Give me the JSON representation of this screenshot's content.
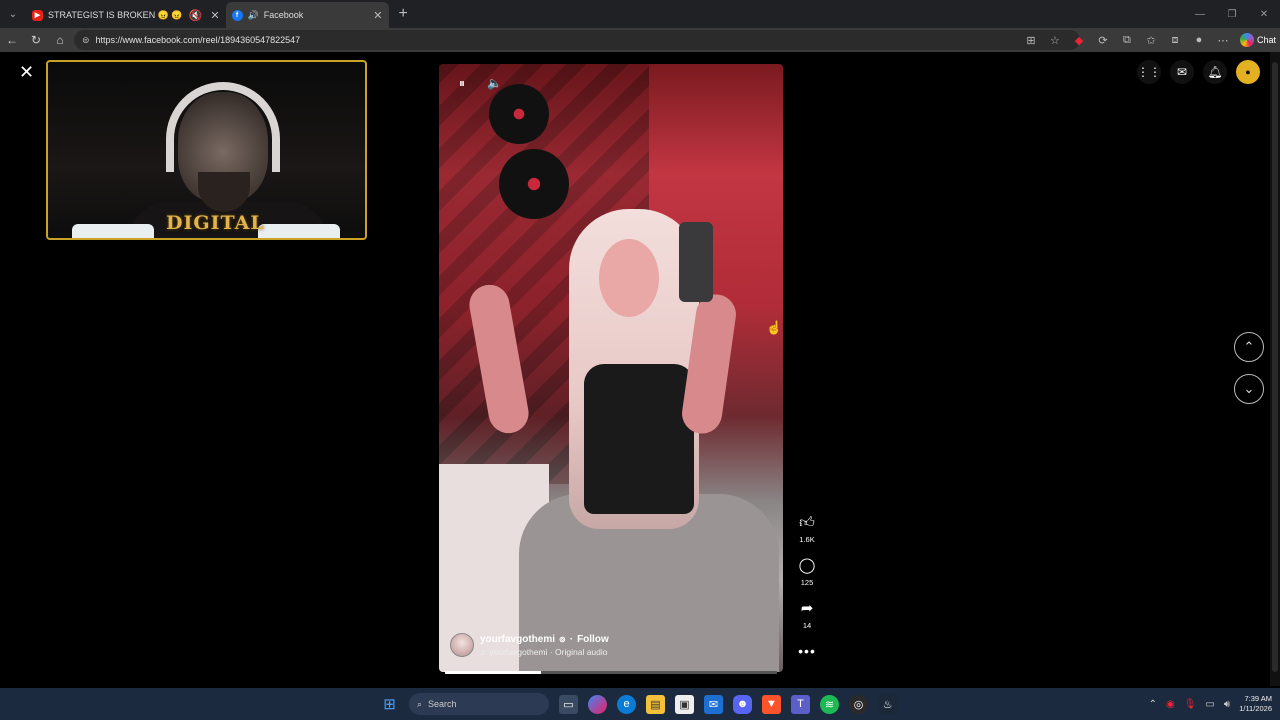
{
  "browser": {
    "tabs": [
      {
        "title": "STRATEGIST IS BROKEN 😠 😠",
        "icon": "youtube-icon",
        "active": false
      },
      {
        "title": "Facebook",
        "icon": "facebook-icon",
        "active": true
      }
    ],
    "url": "https://www.facebook.com/reel/1894360547822547",
    "chat_label": "Chat"
  },
  "reel": {
    "owner_name": "yourfavgothemi",
    "follow_label": "Follow",
    "audio_label": "yourfavgothemi · Original audio",
    "progress_fraction": 0.29
  },
  "actions": {
    "likes": "1.6K",
    "comments": "125",
    "shares": "14"
  },
  "webcam": {
    "logo_text": "DIGITAL"
  },
  "taskbar": {
    "search_placeholder": "Search",
    "time": "7:39 AM",
    "date": "1/11/2026"
  },
  "colors": {
    "webcam_border": "#c9a227",
    "taskbar": "#1c2a3f"
  }
}
